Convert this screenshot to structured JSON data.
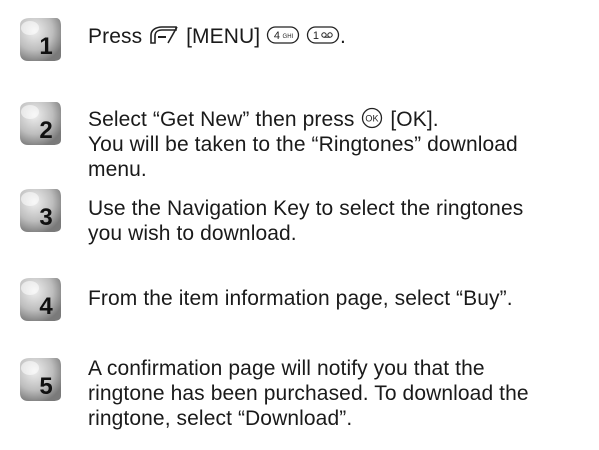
{
  "steps": [
    {
      "number": "1",
      "segments": [
        "Press",
        "[MENU]",
        "."
      ]
    },
    {
      "number": "2",
      "line1_before": "Select “Get New” then press",
      "ok_key_label": "OK",
      "line1_after": "[OK].",
      "line2": "You will be taken to the “Ringtones” download",
      "line3": "menu."
    },
    {
      "number": "3",
      "line1": "Use the Navigation Key to select the ringtones",
      "line2": "you wish to download."
    },
    {
      "number": "4",
      "line1": "From the item information page, select “Buy”."
    },
    {
      "number": "5",
      "line1": "A confirmation page will notify you that the",
      "line2": "ringtone has been purchased. To download the",
      "line3": "ringtone, select “Download”."
    }
  ],
  "icons": {
    "soft_key": "left-soft-key-icon",
    "key_4": "key-4-ghi-icon",
    "key_1": "key-1-voicemail-icon",
    "ok_key": "ok-key-icon"
  },
  "colors": {
    "text": "#1a1a1a",
    "badge_fill_light": "#d4d4d4",
    "badge_fill_dark": "#8a8a8a",
    "badge_number": "#111111"
  }
}
